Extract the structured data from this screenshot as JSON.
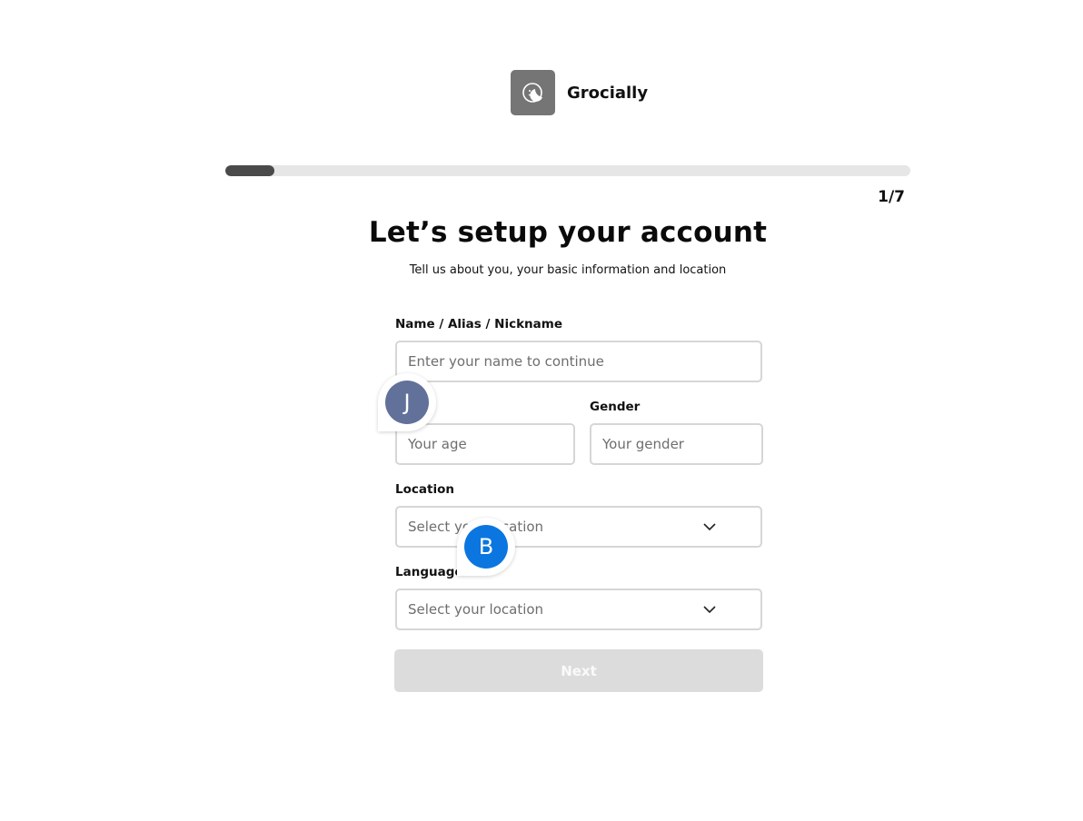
{
  "brand": {
    "name": "Grocially",
    "logo_icon": "smiley-moon-icon",
    "logo_color": "#757575"
  },
  "progress": {
    "fraction": 0.0714,
    "step_label": "1/7"
  },
  "header": {
    "title": "Let’s setup your account",
    "subtitle": "Tell us about you, your basic information and location"
  },
  "form": {
    "name": {
      "label": "Name / Alias / Nickname",
      "placeholder": "Enter your name to continue"
    },
    "age": {
      "placeholder": "Your age"
    },
    "gender": {
      "label": "Gender",
      "placeholder": "Your gender"
    },
    "location": {
      "label": "Location",
      "placeholder": "Select your location"
    },
    "language": {
      "label": "Language",
      "placeholder": "Select your location"
    },
    "next_label": "Next"
  },
  "collaborators": [
    {
      "initial": "J",
      "color": "#62719a"
    },
    {
      "initial": "B",
      "color": "#0b76e0"
    }
  ]
}
